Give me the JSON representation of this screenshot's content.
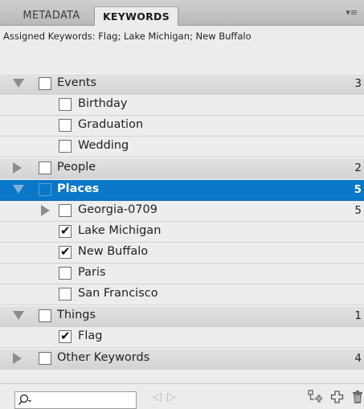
{
  "tabs": [
    {
      "label": "METADATA",
      "active": false
    },
    {
      "label": "KEYWORDS",
      "active": true
    }
  ],
  "assigned_keywords": "Assigned Keywords: Flag; Lake Michigan; New Buffalo",
  "tree": [
    {
      "label": "Events",
      "count": "3",
      "level": 0,
      "expander": "expanded",
      "checked": false,
      "selected": false
    },
    {
      "label": "Birthday",
      "count": "",
      "level": 1,
      "expander": "none",
      "checked": false,
      "selected": false
    },
    {
      "label": "Graduation",
      "count": "",
      "level": 1,
      "expander": "none",
      "checked": false,
      "selected": false
    },
    {
      "label": "Wedding",
      "count": "",
      "level": 1,
      "expander": "none",
      "checked": false,
      "selected": false
    },
    {
      "label": "People",
      "count": "2",
      "level": 0,
      "expander": "collapsed",
      "checked": false,
      "selected": false
    },
    {
      "label": "Places",
      "count": "5",
      "level": 0,
      "expander": "expanded",
      "checked": false,
      "selected": true
    },
    {
      "label": "Georgia-0709",
      "count": "5",
      "level": 1,
      "expander": "collapsed",
      "checked": false,
      "selected": false
    },
    {
      "label": "Lake Michigan",
      "count": "",
      "level": 1,
      "expander": "none",
      "checked": true,
      "selected": false
    },
    {
      "label": "New Buffalo",
      "count": "",
      "level": 1,
      "expander": "none",
      "checked": true,
      "selected": false
    },
    {
      "label": "Paris",
      "count": "",
      "level": 1,
      "expander": "none",
      "checked": false,
      "selected": false
    },
    {
      "label": "San Francisco",
      "count": "",
      "level": 1,
      "expander": "none",
      "checked": false,
      "selected": false
    },
    {
      "label": "Things",
      "count": "1",
      "level": 0,
      "expander": "expanded",
      "checked": false,
      "selected": false
    },
    {
      "label": "Flag",
      "count": "",
      "level": 1,
      "expander": "none",
      "checked": true,
      "selected": false
    },
    {
      "label": "Other Keywords",
      "count": "4",
      "level": 0,
      "expander": "collapsed",
      "checked": false,
      "selected": false
    }
  ],
  "footer": {
    "search_icon": "search-icon",
    "nav_icons": [
      "previous-arrow-icon",
      "next-arrow-icon"
    ],
    "action_icons": [
      "new-sub-keyword-icon",
      "new-keyword-icon",
      "trash-icon"
    ]
  },
  "colors": {
    "selected_row": "#0a77c8",
    "parent_row": "#d9d9d9",
    "child_row": "#ededed"
  }
}
